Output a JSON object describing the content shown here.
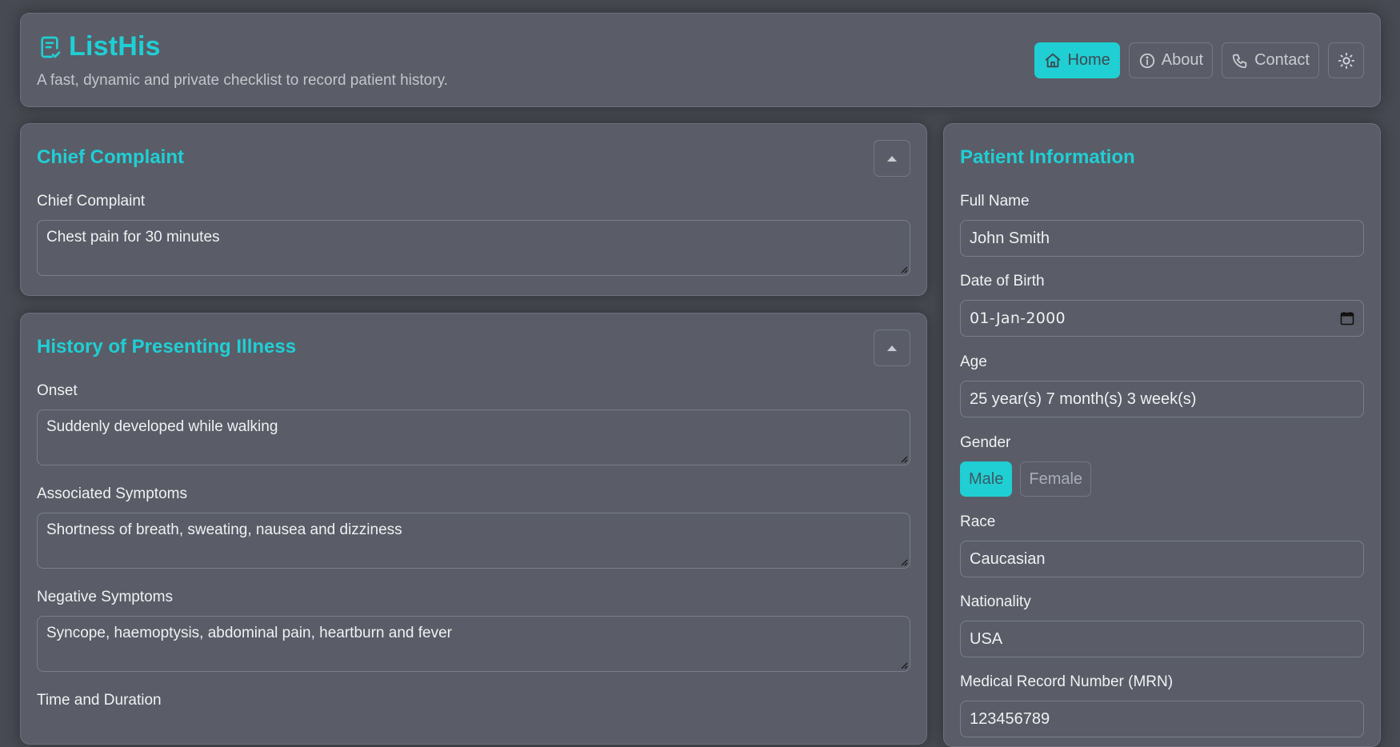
{
  "app": {
    "title": "ListHis",
    "tagline": "A fast, dynamic and private checklist to record patient history.",
    "accent_color": "#1fcfd4",
    "logo_icon": "clipboard-check-icon"
  },
  "nav": {
    "home": "Home",
    "about": "About",
    "contact": "Contact",
    "theme_icon": "sun-icon"
  },
  "chief_complaint": {
    "title": "Chief Complaint",
    "field_label": "Chief Complaint",
    "value": "Chest pain for 30 minutes"
  },
  "hpi": {
    "title": "History of Presenting Illness",
    "onset_label": "Onset",
    "onset_value": "Suddenly developed while walking",
    "associated_label": "Associated Symptoms",
    "associated_value": "Shortness of breath, sweating, nausea and dizziness",
    "negative_label": "Negative Symptoms",
    "negative_value": "Syncope, haemoptysis, abdominal pain, heartburn and fever",
    "time_label": "Time and Duration"
  },
  "patient": {
    "title": "Patient Information",
    "name_label": "Full Name",
    "name_value": "John Smith",
    "dob_label": "Date of Birth",
    "dob_value": "01-Jan-2000",
    "age_label": "Age",
    "age_value": "25 year(s) 7 month(s) 3 week(s)",
    "gender_label": "Gender",
    "gender_options": [
      "Male",
      "Female"
    ],
    "gender_selected": "Male",
    "race_label": "Race",
    "race_value": "Caucasian",
    "nationality_label": "Nationality",
    "nationality_value": "USA",
    "mrn_label": "Medical Record Number (MRN)",
    "mrn_value": "123456789"
  }
}
